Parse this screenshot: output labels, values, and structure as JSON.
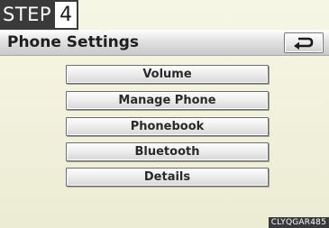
{
  "step": {
    "label": "STEP",
    "number": "4"
  },
  "header": {
    "title": "Phone Settings",
    "back_icon": "return-arrow-icon"
  },
  "menu": {
    "items": [
      {
        "label": "Volume"
      },
      {
        "label": "Manage Phone"
      },
      {
        "label": "Phonebook"
      },
      {
        "label": "Bluetooth"
      },
      {
        "label": "Details"
      }
    ]
  },
  "footer": {
    "code": "CLYQGAR485"
  },
  "colors": {
    "screen_background": "#f1f1dc",
    "badge": "#3a3a3a"
  }
}
